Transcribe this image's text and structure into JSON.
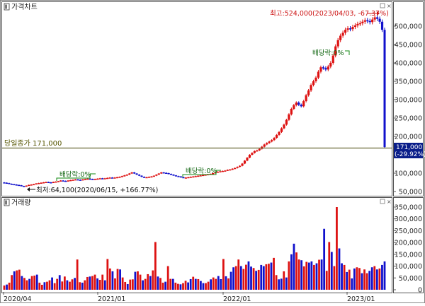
{
  "chart_data": [
    {
      "type": "candlestick",
      "title": "가격차트",
      "price_axis": {
        "ticks": [
          "500,000",
          "450,000",
          "400,000",
          "350,000",
          "300,000",
          "250,000",
          "200,000",
          "150,000",
          "100,000",
          "50,000"
        ],
        "ylim": [
          45000,
          545000
        ]
      },
      "date_axis": {
        "ticks": [
          "2020/04",
          "2021/01",
          "2022/01",
          "2023/01"
        ]
      },
      "current_close": {
        "label": "당일종가 171,000",
        "price_tag": "171,000",
        "change_tag": "(-29.92%)",
        "value": 171000
      },
      "annotations": {
        "high": "최고:524,000(2023/04/03, -67.37%)",
        "low": "최저:64,100(2020/06/15, +166.77%)",
        "ex_dividend": [
          "배당락:0%",
          "배당락:0%",
          "배당락:0%"
        ]
      },
      "series": [
        {
          "values": [
            74000,
            73000,
            71000,
            70000,
            69000,
            68000,
            67000,
            65000,
            64100,
            66000,
            68000,
            69000,
            70000,
            72000,
            73000,
            74000,
            75000,
            76000,
            75000,
            74000,
            76000,
            77000,
            78000,
            80000,
            79000,
            78000,
            80000,
            81000,
            82000,
            83000,
            82000,
            81000,
            83000,
            84000,
            85000,
            84000,
            83000,
            84000,
            85000,
            86000,
            85000,
            86000,
            87000,
            88000,
            87000,
            88000,
            89000,
            90000,
            92000,
            94000,
            96000,
            99000,
            102000,
            99000,
            96000,
            93000,
            90000,
            88000,
            89000,
            90000,
            91000,
            93000,
            96000,
            99000,
            102000,
            101000,
            100000,
            98000,
            96000,
            94000,
            92000,
            91000,
            89000,
            88000,
            88000,
            89000,
            90000,
            91000,
            92000,
            93000,
            94000,
            95000,
            96000,
            97000,
            98000,
            100000,
            102000,
            104000,
            105000,
            106000,
            107000,
            109000,
            110000,
            112000,
            114000,
            117000,
            120000,
            126000,
            134000,
            142000,
            150000,
            155000,
            160000,
            162000,
            166000,
            172000,
            178000,
            182000,
            186000,
            190000,
            196000,
            204000,
            212000,
            222000,
            232000,
            245000,
            260000,
            275000,
            285000,
            292000,
            286000,
            282000,
            296000,
            312000,
            325000,
            340000,
            350000,
            360000,
            376000,
            388000,
            386000,
            382000,
            390000,
            400000,
            420000,
            445000,
            462000,
            474000,
            482000,
            490000,
            494000,
            492000,
            498000,
            502000,
            506000,
            508000,
            512000,
            516000,
            514000,
            511000,
            518000,
            524000,
            520000,
            512000,
            490000,
            171000
          ]
        }
      ]
    },
    {
      "type": "bar",
      "title": "거래량",
      "volume_axis": {
        "ticks": [
          "350,000",
          "300,000",
          "250,000",
          "200,000",
          "150,000",
          "100,000",
          "50,000",
          "0"
        ],
        "ylim": [
          0,
          370000
        ]
      },
      "values": [
        18000,
        22000,
        30000,
        62000,
        78000,
        82000,
        85000,
        58000,
        50000,
        40000,
        46000,
        58000,
        60000,
        64000,
        30000,
        21000,
        32000,
        34000,
        40000,
        52000,
        28000,
        46000,
        62000,
        35000,
        56000,
        40000,
        34000,
        44000,
        50000,
        128000,
        32000,
        30000,
        40000,
        54000,
        56000,
        58000,
        64000,
        48000,
        42000,
        64000,
        40000,
        130000,
        90000,
        78000,
        48000,
        88000,
        86000,
        52000,
        33000,
        24000,
        43000,
        44000,
        76000,
        78000,
        64000,
        40000,
        46000,
        66000,
        58000,
        82000,
        202000,
        56000,
        50000,
        30000,
        34000,
        100000,
        46000,
        46000,
        30000,
        25000,
        23000,
        28000,
        38000,
        31000,
        45000,
        55000,
        46000,
        45000,
        37000,
        28000,
        28000,
        34000,
        44000,
        52000,
        46000,
        58000,
        45000,
        130000,
        57000,
        48000,
        76000,
        95000,
        100000,
        128000,
        100000,
        88000,
        106000,
        120000,
        98000,
        92000,
        80000,
        84000,
        105000,
        100000,
        108000,
        110000,
        115000,
        135000,
        62000,
        44000,
        47000,
        78000,
        52000,
        120000,
        150000,
        195000,
        158000,
        128000,
        125000,
        99000,
        118000,
        115000,
        120000,
        105000,
        112000,
        127000,
        128000,
        258000,
        80000,
        202000,
        160000,
        100000,
        350000,
        175000,
        112000,
        105000,
        75000,
        85000,
        48000,
        90000,
        95000,
        92000,
        70000,
        86000,
        70000,
        80000,
        95000,
        100000,
        86000,
        90000,
        105000,
        120000
      ],
      "colors": {
        "up": "#dd1111",
        "down": "#1111cc"
      }
    }
  ]
}
